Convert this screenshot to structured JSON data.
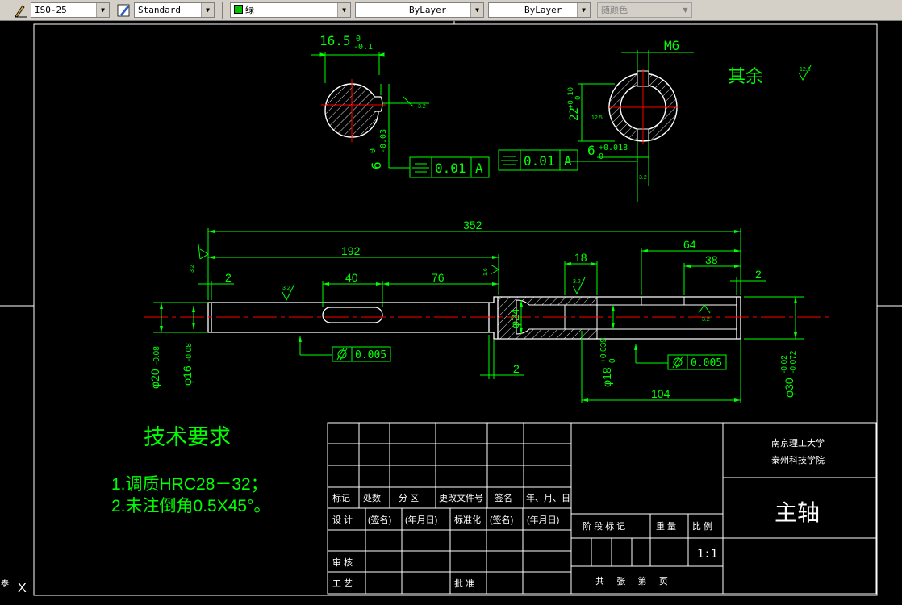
{
  "toolbar": {
    "dimstyle": "ISO-25",
    "textstyle": "Standard",
    "layer": "绿",
    "linetype": "ByLayer",
    "lineweight": "ByLayer",
    "plotstyle": "随颜色"
  },
  "colors": {
    "background": "#000000",
    "green": "#00ff00",
    "white": "#ffffff",
    "red": "#ff0000"
  },
  "section_a": {
    "width_dim": "16.5",
    "width_tol": "0",
    "width_tol_low": "-0.1",
    "depth_dim": "6",
    "depth_tol_up": "0",
    "depth_tol_low": "-0.03",
    "rough": "3.2",
    "sym_value": "0.01",
    "sym_datum": "A"
  },
  "section_b": {
    "thread": "M6",
    "height_dim": "22",
    "height_tol_up": "+0.10",
    "height_tol_low": "0",
    "width_dim": "6",
    "width_tol_up": "+0.018",
    "width_tol_low": "0",
    "rough": "12.5",
    "rough2": "3.2",
    "sym_value": "0.01",
    "sym_datum": "A"
  },
  "rest_rough": {
    "label": "其余",
    "value": "12.5"
  },
  "shaft": {
    "len_total": "352",
    "len_192": "192",
    "len_64": "64",
    "len_38": "38",
    "len_18": "18",
    "len_40": "40",
    "len_76": "76",
    "len_2a": "2",
    "len_2b": "2",
    "len_2c": "2",
    "len_104": "104",
    "dia_20": "φ20",
    "dia_20_tol": "-0.08",
    "dia_16": "φ16",
    "dia_16_tol": "-0.08",
    "dia_24": "φ24",
    "dia_18": "φ18",
    "dia_18_tol_up": "+0.039",
    "dia_18_tol_low": "0",
    "dia_30": "φ30",
    "dia_30_tol_up": "-0.02",
    "dia_30_tol_low": "-0.072",
    "rough_a": "3.2",
    "rough_b": "1.6",
    "rough_c": "3.2",
    "rough_d": "3.2",
    "rough_e": "3.2",
    "cyl_tol_1": "0.005",
    "cyl_tol_2": "0.005"
  },
  "requirements": {
    "title": "技术要求",
    "item1": "1.调质HRC28－32；",
    "item2": "2.未注倒角0.5X45°。"
  },
  "title_block": {
    "mark": "标记",
    "count": "处数",
    "zone": "分 区",
    "doc_no": "更改文件号",
    "sign": "签名",
    "date": "年、月、日",
    "design": "设 计",
    "sign_paren": "(签名)",
    "date_paren": "(年月日)",
    "standard": "标准化",
    "sign_paren2": "(签名)",
    "date_paren2": "(年月日)",
    "review": "审 核",
    "process": "工 艺",
    "approve": "批 准",
    "stage": "阶 段 标 记",
    "weight": "重 量",
    "scale": "比 例",
    "scale_value": "1:1",
    "sheets": "共     张     第     页",
    "school1": "南京理工大学",
    "school2": "泰州科技学院",
    "part_name": "主轴"
  }
}
